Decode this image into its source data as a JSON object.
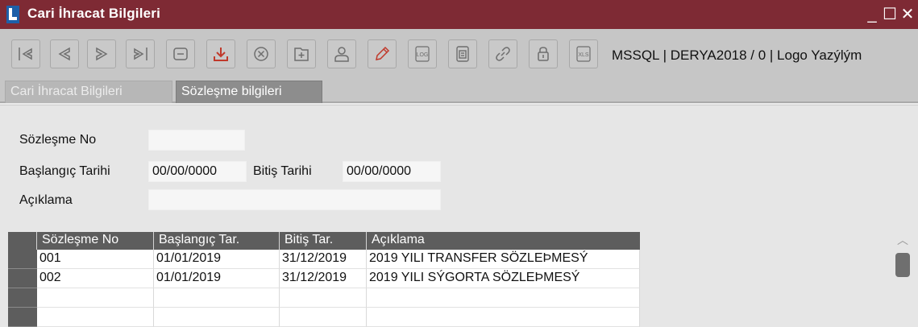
{
  "window": {
    "title": "Cari İhracat Bilgileri",
    "minimize": "_",
    "maximize": "☐",
    "close": "✕"
  },
  "toolbar": {
    "buttons": [
      {
        "icon": "first-record-icon"
      },
      {
        "icon": "previous-record-icon"
      },
      {
        "icon": "next-record-icon"
      },
      {
        "icon": "last-record-icon"
      },
      {
        "icon": "minimize-record-icon"
      },
      {
        "icon": "download-icon"
      },
      {
        "icon": "cancel-icon"
      },
      {
        "icon": "add-icon"
      },
      {
        "icon": "user-icon"
      },
      {
        "icon": "edit-pencil-icon"
      },
      {
        "icon": "log-icon"
      },
      {
        "icon": "document-icon"
      },
      {
        "icon": "link-icon"
      },
      {
        "icon": "lock-icon"
      },
      {
        "icon": "excel-export-icon"
      }
    ],
    "log_text": "LOG",
    "xls_text": "XLS",
    "connection_info": "MSSQL | DERYA2018 / 0 | Logo Yazýlým"
  },
  "tabs": [
    {
      "label": "Cari İhracat Bilgileri",
      "active": false
    },
    {
      "label": "Sözleşme bilgileri",
      "active": true
    }
  ],
  "form": {
    "contract_no_label": "Sözleşme No",
    "contract_no_value": "",
    "start_date_label": "Başlangıç Tarihi",
    "start_date_value": "00/00/0000",
    "end_date_label": "Bitiş Tarihi",
    "end_date_value": "00/00/0000",
    "description_label": "Açıklama",
    "description_value": ""
  },
  "grid": {
    "columns": [
      "Sözleşme No",
      "Başlangıç Tar.",
      "Bitiş Tar.",
      "Açıklama"
    ],
    "rows": [
      [
        "001",
        "01/01/2019",
        "31/12/2019",
        "2019 YILI TRANSFER SÖZLEÞMESÝ"
      ],
      [
        "002",
        "01/01/2019",
        "31/12/2019",
        "2019 YILI SÝGORTA SÖZLEÞMESÝ"
      ],
      [
        "",
        "",
        "",
        ""
      ],
      [
        "",
        "",
        "",
        ""
      ]
    ]
  },
  "colors": {
    "title_bar": "#7e2a34",
    "toolbar": "#c6c6c6",
    "grid_header": "#5d5d5d",
    "download_icon": "#c0392b"
  }
}
